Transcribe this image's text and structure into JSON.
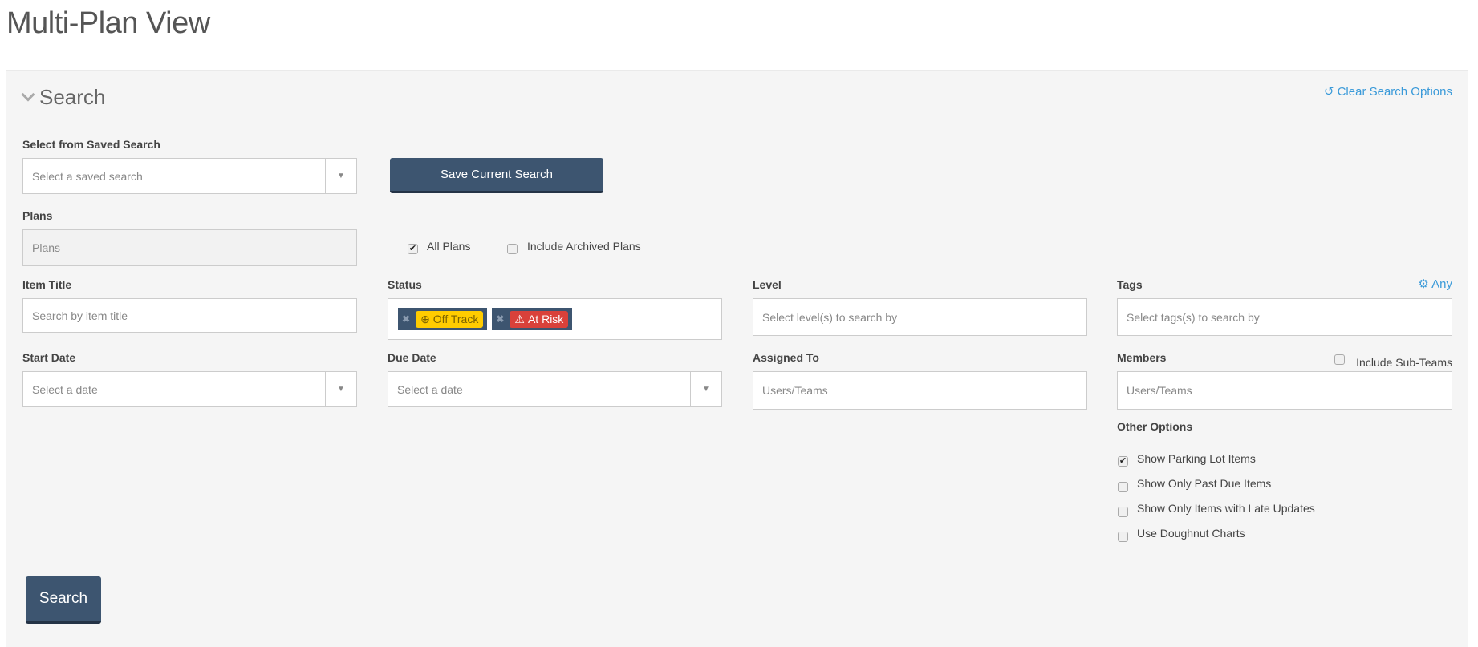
{
  "page_title": "Multi-Plan View",
  "search": {
    "header": "Search",
    "clear_label": "Clear Search Options",
    "saved_search": {
      "label": "Select from Saved Search",
      "placeholder": "Select a saved search"
    },
    "save_button": "Save Current Search",
    "plans": {
      "label": "Plans",
      "placeholder": "Plans",
      "all_plans": "All Plans",
      "all_plans_checked": true,
      "include_archived": "Include Archived Plans",
      "include_archived_checked": false
    },
    "item_title": {
      "label": "Item Title",
      "placeholder": "Search by item title"
    },
    "status": {
      "label": "Status",
      "tags": [
        {
          "label": "Off Track",
          "icon": "arrow-down-circle-icon",
          "color": "#ffcc00",
          "text_color": "#7a6200"
        },
        {
          "label": "At Risk",
          "icon": "warning-icon",
          "color": "#d9413a",
          "text_color": "#ffffff"
        }
      ]
    },
    "level": {
      "label": "Level",
      "placeholder": "Select level(s) to search by"
    },
    "tags": {
      "label": "Tags",
      "mode": "Any",
      "placeholder": "Select tags(s) to search by"
    },
    "start_date": {
      "label": "Start Date",
      "placeholder": "Select a date"
    },
    "due_date": {
      "label": "Due Date",
      "placeholder": "Select a date"
    },
    "assigned_to": {
      "label": "Assigned To",
      "placeholder": "Users/Teams"
    },
    "members": {
      "label": "Members",
      "placeholder": "Users/Teams",
      "include_sub_teams": "Include Sub-Teams",
      "include_sub_teams_checked": false
    },
    "other_options": {
      "label": "Other Options",
      "items": [
        {
          "label": "Show Parking Lot Items",
          "checked": true
        },
        {
          "label": "Show Only Past Due Items",
          "checked": false
        },
        {
          "label": "Show Only Items with Late Updates",
          "checked": false
        },
        {
          "label": "Use Doughnut Charts",
          "checked": false
        }
      ]
    },
    "search_button": "Search"
  },
  "colors": {
    "primary": "#3d5570",
    "link": "#3a9ad9"
  }
}
